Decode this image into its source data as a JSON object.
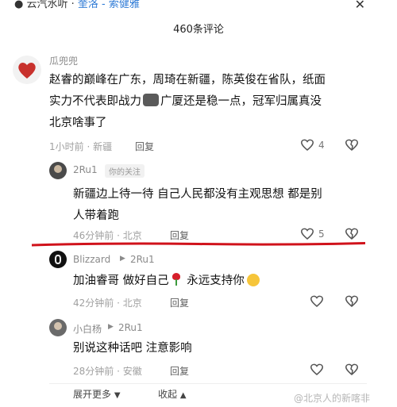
{
  "header": {
    "source_prefix": "云汽水听 · ",
    "source_highlight": "奎洛 - 索健雅",
    "close": "✕"
  },
  "title": "460条评论",
  "comments": [
    {
      "user": "瓜兜兜",
      "text_lines": [
        "赵睿的巅峰在广东，周琦在新疆，陈英俊在省队，纸面",
        "实力不代表即战力",
        "广厦还是稳一点，冠军归属真没",
        "北京啥事了"
      ],
      "meta": "1小时前 · 新疆",
      "reply": "回复",
      "likes": "4"
    },
    {
      "user": "2Ru1",
      "badge": "你的关注",
      "text_lines": [
        "新疆边上待一待 自己人民都没有主观思想 都是别",
        "人带着跑"
      ],
      "meta": "46分钟前 · 北京",
      "reply": "回复",
      "likes": "5"
    },
    {
      "user": "Blizzard",
      "arrow": "▶",
      "to": "2Ru1",
      "text_pre": "加油睿哥 做好自己",
      "text_post": " 永远支持你",
      "meta": "42分钟前 · 北京",
      "reply": "回复"
    },
    {
      "user": "小白杨",
      "arrow": "▶",
      "to": "2Ru1",
      "text": "别说这种话吧 注意影响",
      "meta": "28分钟前 · 安徽",
      "reply": "回复"
    }
  ],
  "footer": {
    "expand": "展开更多",
    "collapse": "收起",
    "watermark": "@北京人的新喀非"
  },
  "colors": {
    "underline": "#d0121b",
    "heart": "#c8312d",
    "link": "#2f7bd6"
  }
}
